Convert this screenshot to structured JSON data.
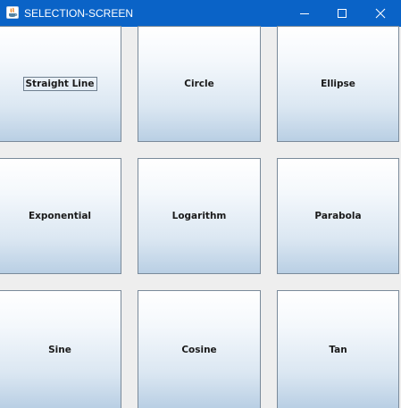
{
  "window": {
    "title": "SELECTION-SCREEN",
    "titlebar_color": "#0a63c7",
    "app_icon": "java-icon",
    "controls": {
      "minimize_icon": "minimize-icon",
      "maximize_icon": "maximize-icon",
      "close_icon": "close-icon"
    }
  },
  "buttons": [
    {
      "label": "Straight Line",
      "focused": true
    },
    {
      "label": "Circle"
    },
    {
      "label": "Ellipse"
    },
    {
      "label": "Exponential"
    },
    {
      "label": "Logarithm"
    },
    {
      "label": "Parabola"
    },
    {
      "label": "Sine"
    },
    {
      "label": "Cosine"
    },
    {
      "label": "Tan"
    }
  ]
}
